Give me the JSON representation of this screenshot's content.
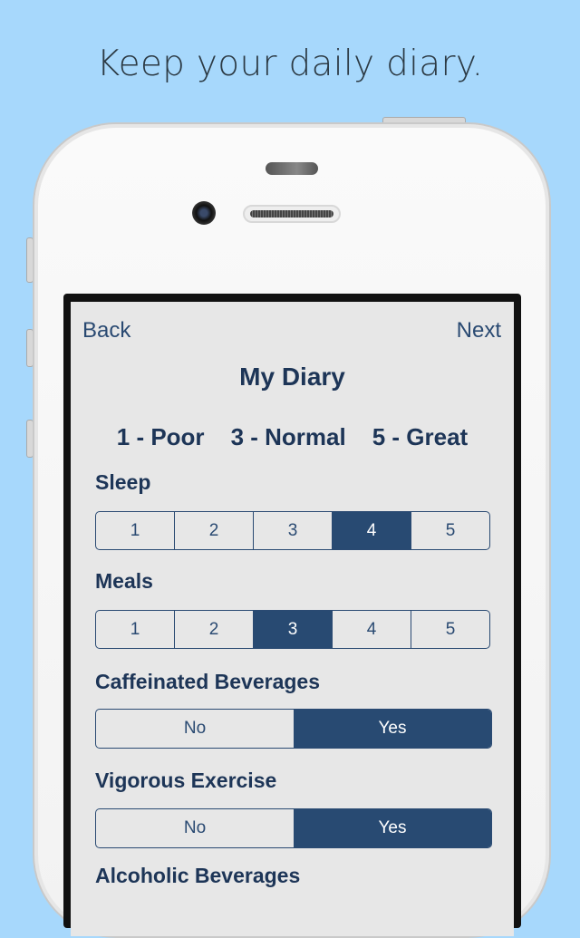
{
  "headline": "Keep your daily diary.",
  "nav": {
    "back": "Back",
    "next": "Next"
  },
  "title": "My Diary",
  "scale": [
    "1 - Poor",
    "3 - Normal",
    "5 - Great"
  ],
  "questions": [
    {
      "label": "Sleep",
      "options": [
        "1",
        "2",
        "3",
        "4",
        "5"
      ],
      "selected": "4"
    },
    {
      "label": "Meals",
      "options": [
        "1",
        "2",
        "3",
        "4",
        "5"
      ],
      "selected": "3"
    },
    {
      "label": "Caffeinated Beverages",
      "options": [
        "No",
        "Yes"
      ],
      "selected": "Yes"
    },
    {
      "label": "Vigorous Exercise",
      "options": [
        "No",
        "Yes"
      ],
      "selected": "Yes"
    },
    {
      "label": "Alcoholic Beverages"
    }
  ],
  "colors": {
    "background": "#a7d8fc",
    "accent": "#284a72",
    "text": "#1d3557",
    "screen": "#e7e7e7"
  }
}
